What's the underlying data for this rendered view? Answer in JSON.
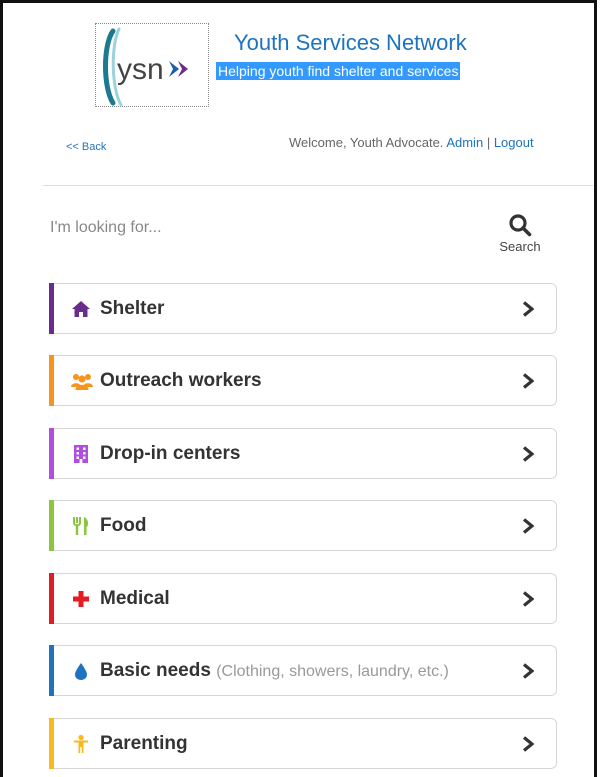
{
  "header": {
    "logo_text": "ysn",
    "title": "Youth Services Network",
    "tagline": "Helping youth find shelter and services"
  },
  "nav": {
    "back_label": "<< Back",
    "welcome_prefix": "Welcome, Youth Advocate.",
    "admin_label": "Admin",
    "separator": "|",
    "logout_label": "Logout"
  },
  "search": {
    "prompt": "I'm looking for...",
    "button_label": "Search",
    "icon": "search-icon"
  },
  "categories": [
    {
      "label": "Shelter",
      "note": "",
      "icon": "home-icon",
      "color": "#6a2c8c"
    },
    {
      "label": "Outreach workers",
      "note": "",
      "icon": "group-icon",
      "color": "#f7941d"
    },
    {
      "label": "Drop-in centers",
      "note": "",
      "icon": "building-icon",
      "color": "#b04ee0"
    },
    {
      "label": "Food",
      "note": "",
      "icon": "utensils-icon",
      "color": "#8cc63f"
    },
    {
      "label": "Medical",
      "note": "",
      "icon": "plus-icon",
      "color": "#e31b23"
    },
    {
      "label": "Basic needs",
      "note": "(Clothing, showers, laundry, etc.)",
      "icon": "drop-icon",
      "color": "#1e73be"
    },
    {
      "label": "Parenting",
      "note": "",
      "icon": "child-icon",
      "color": "#f9b81b"
    }
  ]
}
